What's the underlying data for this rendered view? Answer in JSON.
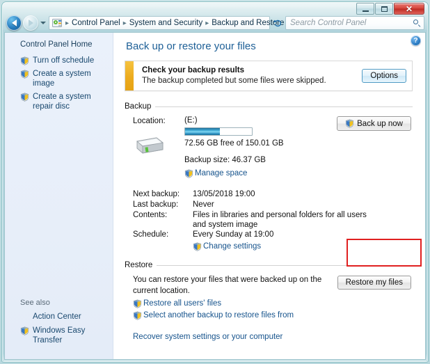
{
  "window": {
    "controls": {
      "minimize_label": "Minimize",
      "maximize_label": "Maximize",
      "close_label": "✕"
    }
  },
  "navbar": {
    "back_label": "Back",
    "forward_label": "Forward",
    "history_label": "Recent pages",
    "breadcrumbs": [
      "Control Panel",
      "System and Security",
      "Backup and Restore"
    ],
    "separator": "▸",
    "dropdown_label": "Previous locations",
    "refresh_label": "Refresh",
    "search": {
      "value": "",
      "placeholder": "Search Control Panel"
    }
  },
  "sidebar": {
    "home_label": "Control Panel Home",
    "items": [
      {
        "label": "Turn off schedule",
        "icon": "shield-icon"
      },
      {
        "label": "Create a system image",
        "icon": "shield-icon"
      },
      {
        "label": "Create a system repair disc",
        "icon": "shield-icon"
      }
    ],
    "see_also": {
      "title": "See also",
      "items": [
        {
          "label": "Action Center",
          "icon": "none"
        },
        {
          "label": "Windows Easy Transfer",
          "icon": "shield-icon"
        }
      ]
    }
  },
  "main": {
    "help_label": "?",
    "page_title": "Back up or restore your files",
    "banner": {
      "title": "Check your backup results",
      "subtitle": "The backup completed but some files were skipped.",
      "button_label": "Options",
      "stripe_color": "#ecab1e"
    },
    "backup_section": {
      "heading": "Backup",
      "location_label": "Location:",
      "location_value": "(E:)",
      "progress_percent": 52,
      "free_space_text": "72.56 GB free of 150.01 GB",
      "backup_size_text": "Backup size: 46.37 GB",
      "manage_space_label": "Manage space",
      "backup_now_button": "Back up now",
      "details": [
        {
          "key": "Next backup:",
          "value": "13/05/2018 19:00"
        },
        {
          "key": "Last backup:",
          "value": "Never"
        },
        {
          "key": "Contents:",
          "value": "Files in libraries and personal folders for all users and system image"
        },
        {
          "key": "Schedule:",
          "value": "Every Sunday at 19:00"
        }
      ],
      "change_settings_label": "Change settings"
    },
    "restore_section": {
      "heading": "Restore",
      "description": "You can restore your files that were backed up on the current location.",
      "links": [
        {
          "label": "Restore all users' files",
          "icon": "shield-icon"
        },
        {
          "label": "Select another backup to restore files from",
          "icon": "shield-icon"
        }
      ],
      "restore_button_label": "Restore my files",
      "recover_link_label": "Recover system settings or your computer"
    }
  },
  "annotation": {
    "highlight_color": "#e02020"
  }
}
